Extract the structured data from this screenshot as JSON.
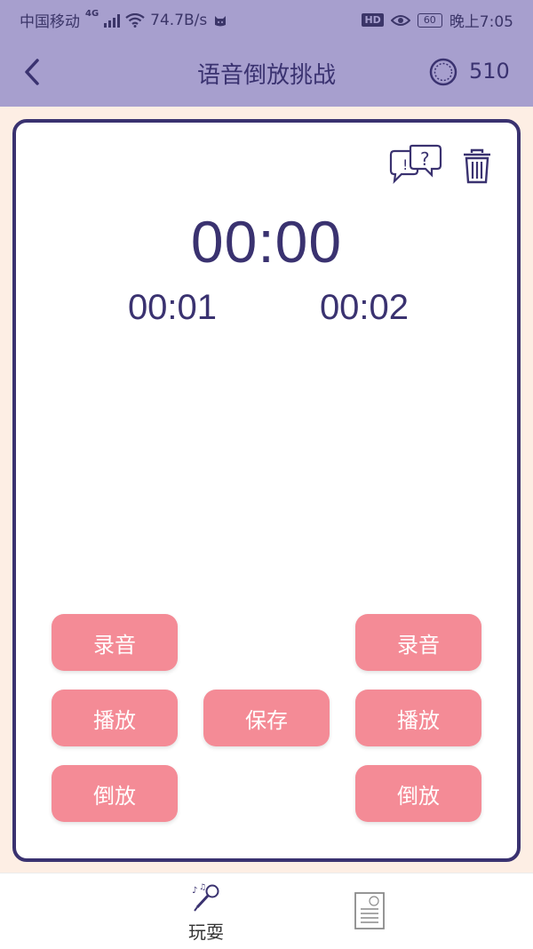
{
  "status": {
    "carrier": "中国移动",
    "network": "4G",
    "speed": "74.7B/s",
    "hd": "HD",
    "battery": "60",
    "time": "晚上7:05"
  },
  "header": {
    "title": "语音倒放挑战",
    "coin_count": "510"
  },
  "timers": {
    "main": "00:00",
    "left": "00:01",
    "right": "00:02"
  },
  "buttons": {
    "left_record": "录音",
    "left_play": "播放",
    "left_reverse": "倒放",
    "save": "保存",
    "right_record": "录音",
    "right_play": "播放",
    "right_reverse": "倒放"
  },
  "nav": {
    "play_label": "玩耍"
  },
  "colors": {
    "header_bg": "#a79fce",
    "accent": "#3a3270",
    "button": "#f48b96",
    "page_bg": "#fdeee4"
  }
}
